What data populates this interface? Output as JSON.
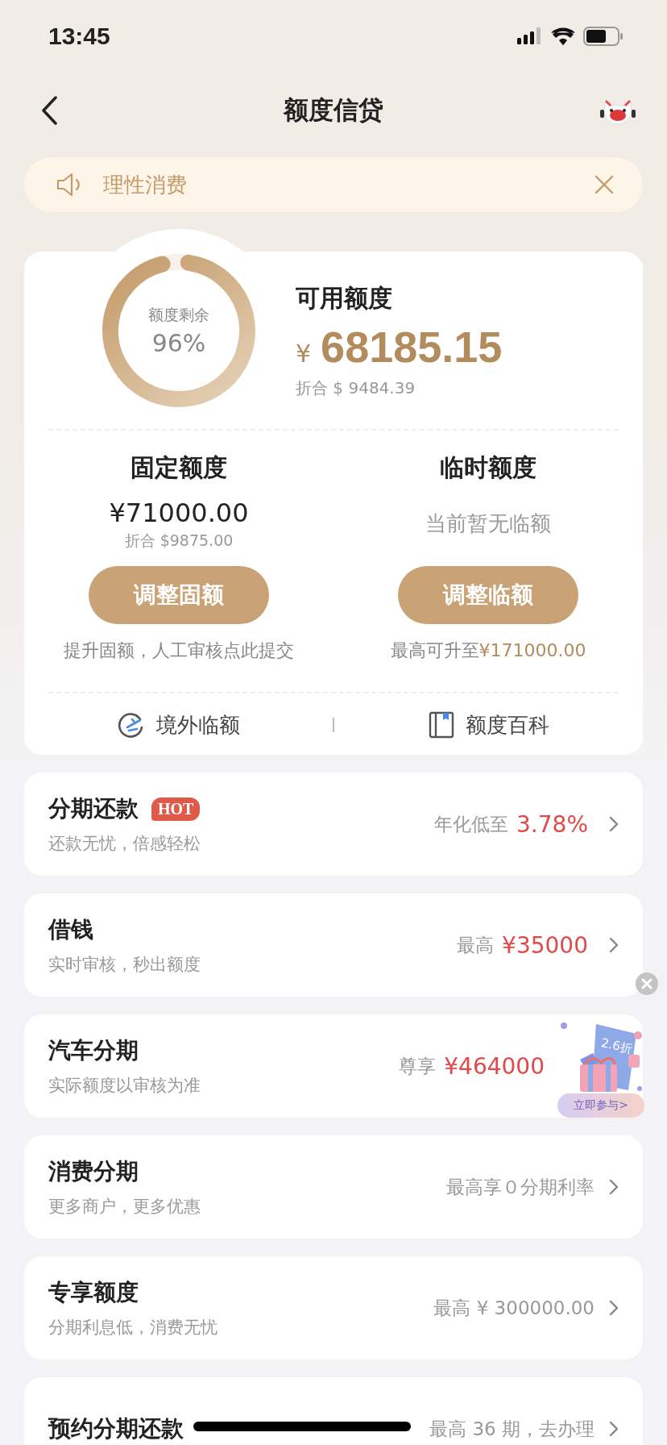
{
  "status_bar": {
    "time": "13:45"
  },
  "nav": {
    "title": "额度信贷"
  },
  "notice": {
    "text": "理性消费"
  },
  "credit": {
    "ring_label": "额度剩余",
    "ring_value": "96%",
    "level": 0.96,
    "title": "可用额度",
    "currency": "¥",
    "amount": "68185.15",
    "converted": "折合 $ 9484.39"
  },
  "limits": [
    {
      "title": "固定额度",
      "amount": "¥71000.00",
      "converted": "折合 $9875.00",
      "button": "调整固额",
      "note": "提升固额，人工审核点此提交"
    },
    {
      "title": "临时额度",
      "status": "当前暂无临额",
      "button": "调整临额",
      "note": "最高可升至",
      "note_value": "¥171000.00"
    }
  ],
  "links": [
    {
      "kind": "plane",
      "label": "境外临额"
    },
    {
      "kind": "book",
      "label": "额度百科"
    }
  ],
  "products": [
    {
      "title": "分期还款",
      "badge": "HOT",
      "subtitle": "还款无忧，倍感轻松",
      "label": "年化低至",
      "value": "3.78%"
    },
    {
      "title": "借钱",
      "subtitle": "实时审核，秒出额度",
      "label": "最高",
      "value": "¥35000"
    },
    {
      "title": "汽车分期",
      "subtitle": "实际额度以审核为准",
      "label": "尊享",
      "value": "¥464000"
    },
    {
      "title": "消费分期",
      "subtitle": "更多商户，更多优惠",
      "label": "最高享０分期利率"
    },
    {
      "title": "专享额度",
      "subtitle": "分期利息低，消费无忧",
      "label": "最高 ¥ 300000.00"
    },
    {
      "title": "预约分期还款",
      "label": "最高 36 期，去办理"
    }
  ],
  "promo": {
    "discount": "2.6折",
    "action": "立即参与>"
  }
}
